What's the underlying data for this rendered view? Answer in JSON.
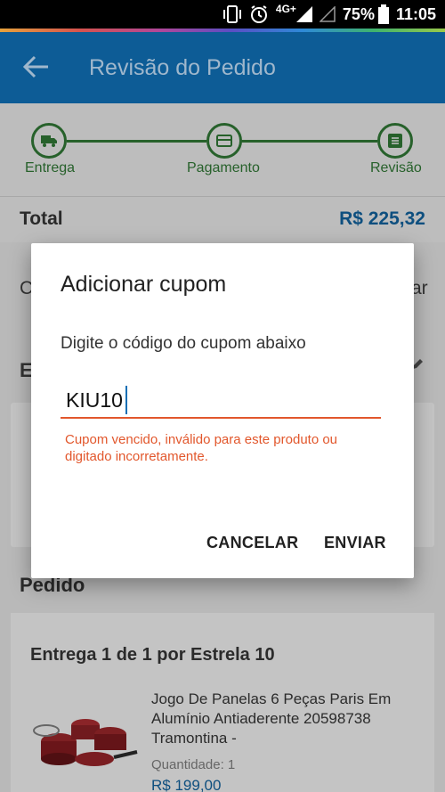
{
  "status_bar": {
    "network": "4G+",
    "battery": "75%",
    "time": "11:05"
  },
  "app_bar": {
    "title": "Revisão do Pedido",
    "back_icon": "arrow-left-icon"
  },
  "stepper": {
    "steps": [
      {
        "label": "Entrega",
        "icon": "truck-icon"
      },
      {
        "label": "Pagamento",
        "icon": "card-icon"
      },
      {
        "label": "Revisão",
        "icon": "list-icon"
      }
    ],
    "color": "#27612b"
  },
  "summary": {
    "total_label": "Total",
    "total_value": "R$ 225,32"
  },
  "behind_text": {
    "left_c": "C",
    "right_ar": "ar",
    "left_e": "E"
  },
  "order": {
    "section_title": "Pedido",
    "delivery": "Entrega 1 de 1 por Estrela 10",
    "product_name": "Jogo De Panelas 6 Peças Paris Em Alumínio Antiaderente 20598738 Tramontina -",
    "quantity": "Quantidade:  1",
    "price": "R$ 199,00"
  },
  "dialog": {
    "title": "Adicionar cupom",
    "message": "Digite o código do cupom abaixo",
    "coupon_value": "KIU10",
    "error": "Cupom vencido, inválido para este produto ou digitado incorretamente.",
    "cancel_label": "CANCELAR",
    "submit_label": "ENVIAR"
  },
  "colors": {
    "app_bar": "#0d5c96",
    "error": "#e2572c",
    "price": "#0e4f7f"
  }
}
